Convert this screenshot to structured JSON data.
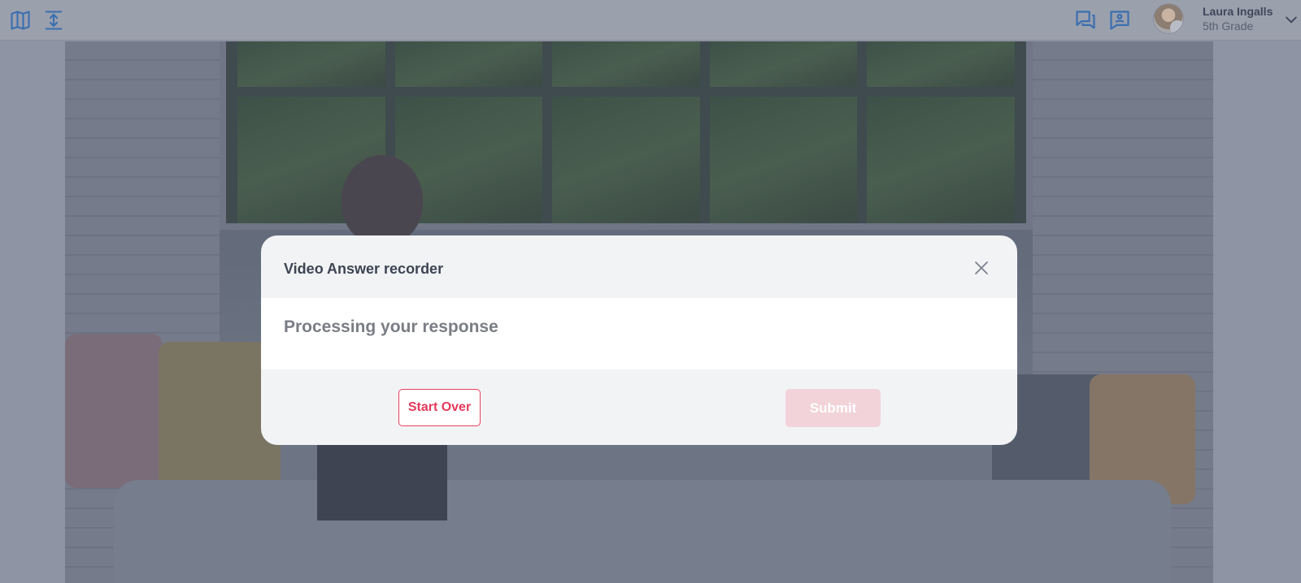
{
  "topbar": {
    "left_icons": [
      "map-icon",
      "expand-vertical-icon"
    ],
    "right_icons": [
      "chat-bubbles-icon",
      "contact-message-icon"
    ],
    "user": {
      "name": "Laura Ingalls",
      "grade": "5th Grade",
      "dropdown_icon": "chevron-down-icon"
    }
  },
  "modal": {
    "title": "Video Answer recorder",
    "close_icon": "close-icon",
    "status_text": "Processing your response",
    "start_over_label": "Start Over",
    "submit_label": "Submit",
    "submit_disabled": true
  },
  "colors": {
    "accent": "#e33a5b",
    "icon_blue": "#3a6fb0",
    "submit_disabled_bg": "#f2d3da"
  }
}
